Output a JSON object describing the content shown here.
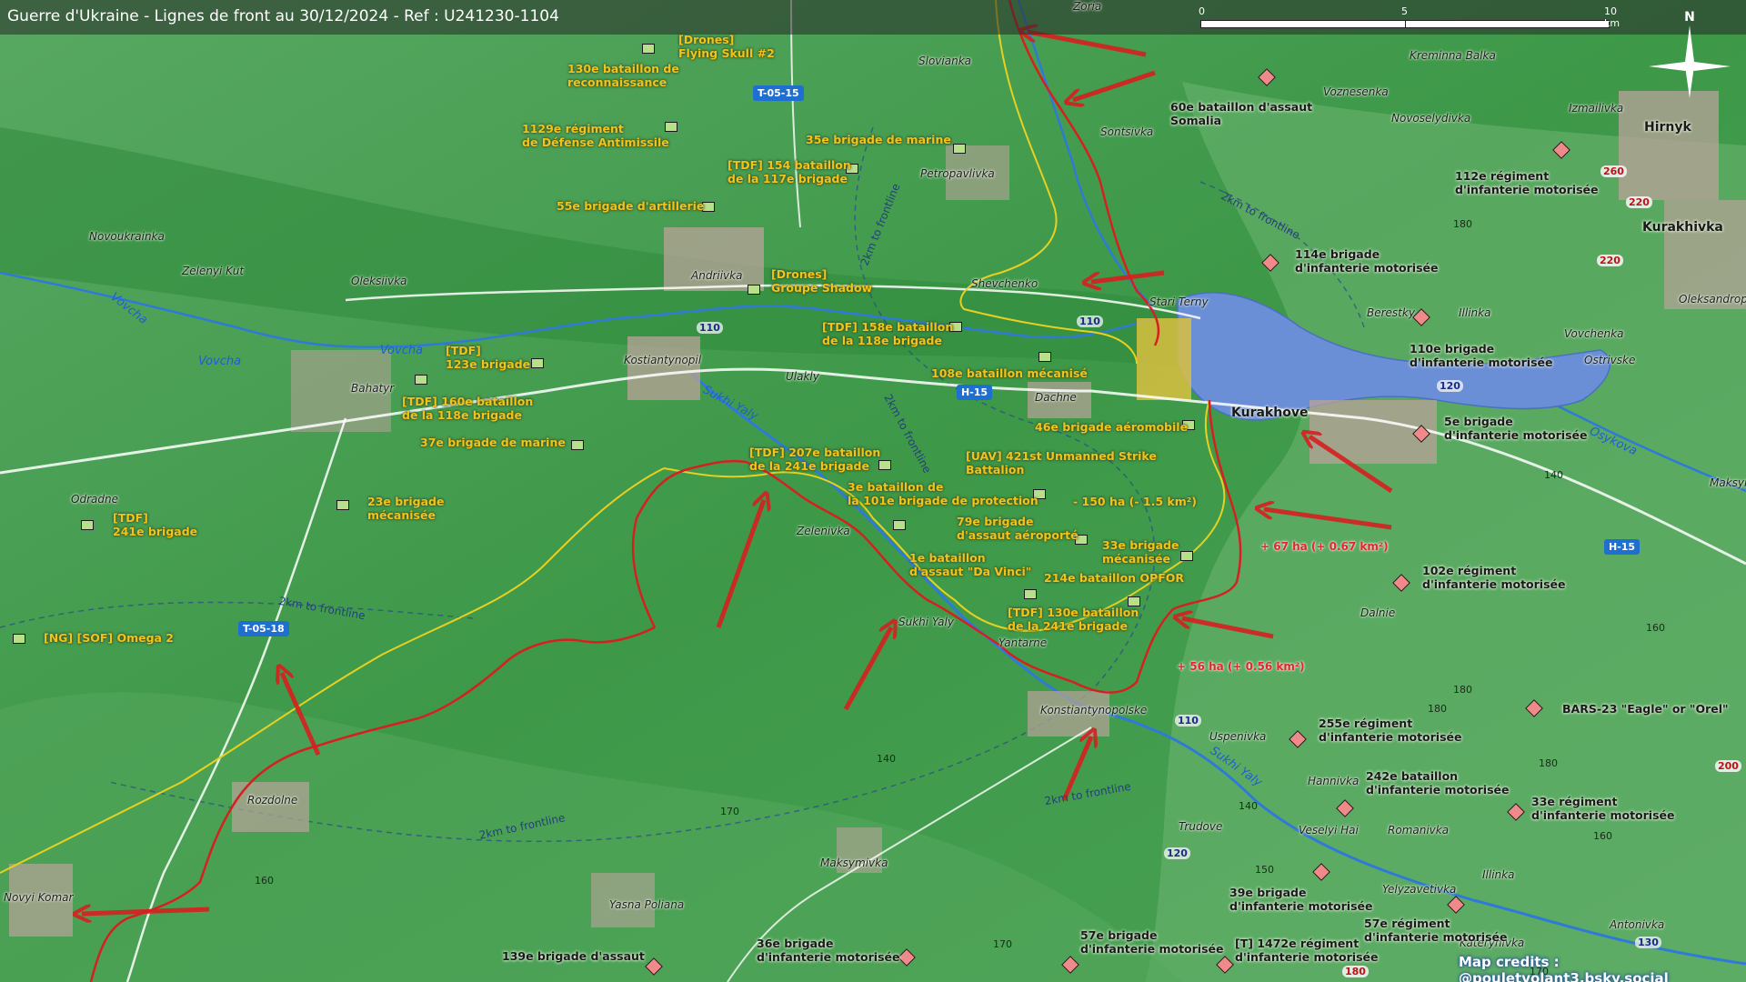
{
  "title": "Guerre d'Ukraine - Lignes de front au 30/12/2024 - Ref : U241230-1104",
  "scale": {
    "labels": [
      "0",
      "5",
      "10 km"
    ]
  },
  "compass": {
    "label": "N",
    "icon": "compass-rose-icon"
  },
  "credits": "Map credits : @pouletvolant3.bsky.social",
  "colors": {
    "terrain": "#3f9a4a",
    "frontline": "#d62020",
    "secondary_line": "#e8d020",
    "ua_unit_text": "#f0c419",
    "ru_unit_text": "#1a1a1a",
    "water": "#6b8fd6",
    "road_badge": "#1f6fd0"
  },
  "towns": [
    {
      "name": "Slovianka"
    },
    {
      "name": "Sontsivka"
    },
    {
      "name": "Voznesenka"
    },
    {
      "name": "Kreminna Balka"
    },
    {
      "name": "Novoselydivka"
    },
    {
      "name": "Izmailivka"
    },
    {
      "name": "Petropavlivka"
    },
    {
      "name": "Novoukrainka"
    },
    {
      "name": "Zelenyi Kut"
    },
    {
      "name": "Oleksiivka"
    },
    {
      "name": "Andriivka"
    },
    {
      "name": "Shevchenko"
    },
    {
      "name": "Stari Terny"
    },
    {
      "name": "Berestky"
    },
    {
      "name": "Illinka"
    },
    {
      "name": "Oleksandropil"
    },
    {
      "name": "Vovchenka"
    },
    {
      "name": "Ostrivske"
    },
    {
      "name": "Kostiantynopil"
    },
    {
      "name": "Ulakly"
    },
    {
      "name": "Bahatyr"
    },
    {
      "name": "Dachne"
    },
    {
      "name": "Odradne"
    },
    {
      "name": "Rozdolne"
    },
    {
      "name": "Zelenivka"
    },
    {
      "name": "Sukhi Yaly"
    },
    {
      "name": "Yantarne"
    },
    {
      "name": "Dalnie"
    },
    {
      "name": "Konstiantynopolske"
    },
    {
      "name": "Uspenivka"
    },
    {
      "name": "Hannivka"
    },
    {
      "name": "Trudove"
    },
    {
      "name": "Veselyi Hai"
    },
    {
      "name": "Romanivka"
    },
    {
      "name": "Illinka"
    },
    {
      "name": "Yelyzavetivka"
    },
    {
      "name": "Antonivka"
    },
    {
      "name": "Katerynivka"
    },
    {
      "name": "Maksymivka"
    },
    {
      "name": "Yasna Poliana"
    },
    {
      "name": "Novyi Komar"
    },
    {
      "name": "Maksym"
    },
    {
      "name": "Zoria"
    }
  ],
  "major_towns": [
    {
      "name": "Hirnyk"
    },
    {
      "name": "Kurakhivka"
    },
    {
      "name": "Kurakhove"
    }
  ],
  "rivers": [
    {
      "name": "Vovcha"
    },
    {
      "name": "Vovcha"
    },
    {
      "name": "Vovcha"
    },
    {
      "name": "Sukhi Yaly"
    },
    {
      "name": "Sukhi Yaly"
    },
    {
      "name": "Osykova"
    }
  ],
  "road_badges": [
    {
      "label": "T-05-15"
    },
    {
      "label": "H-15"
    },
    {
      "label": "T-05-18"
    },
    {
      "label": "H-15"
    }
  ],
  "road_numbers": [
    {
      "label": "110"
    },
    {
      "label": "110"
    },
    {
      "label": "120"
    },
    {
      "label": "110"
    },
    {
      "label": "120"
    },
    {
      "label": "130"
    }
  ],
  "red_road_numbers": [
    {
      "label": "260"
    },
    {
      "label": "220"
    },
    {
      "label": "220"
    },
    {
      "label": "180"
    },
    {
      "label": "200"
    }
  ],
  "elevations": [
    {
      "label": "180"
    },
    {
      "label": "140"
    },
    {
      "label": "160"
    },
    {
      "label": "180"
    },
    {
      "label": "140"
    },
    {
      "label": "180"
    },
    {
      "label": "170"
    },
    {
      "label": "140"
    },
    {
      "label": "150"
    },
    {
      "label": "160"
    },
    {
      "label": "160"
    },
    {
      "label": "170"
    },
    {
      "label": "170"
    },
    {
      "label": "180"
    }
  ],
  "frontline_labels": [
    {
      "label": "2km to frontline"
    },
    {
      "label": "2km to frontline"
    },
    {
      "label": "2km to frontline"
    },
    {
      "label": "2km to frontline"
    },
    {
      "label": "2km to frontline"
    },
    {
      "label": "2km to frontline"
    }
  ],
  "ua_units": [
    {
      "label": "[Drones]\nFlying Skull #2"
    },
    {
      "label": "130e bataillon de\nreconnaissance"
    },
    {
      "label": "1129e régiment\nde Défense Antimissile"
    },
    {
      "label": "35e brigade de marine"
    },
    {
      "label": "[TDF] 154 bataillon\nde la 117e brigade"
    },
    {
      "label": "55e brigade d'artillerie"
    },
    {
      "label": "[Drones]\nGroupe Shadow"
    },
    {
      "label": "[TDF] 158e bataillon\nde la 118e brigade"
    },
    {
      "label": "[TDF]\n123e brigade"
    },
    {
      "label": "108e bataillon mécanisé"
    },
    {
      "label": "[TDF] 160e bataillon\nde la 118e brigade"
    },
    {
      "label": "46e brigade aéromobile"
    },
    {
      "label": "37e brigade de marine"
    },
    {
      "label": "[TDF] 207e bataillon\nde la 241e brigade"
    },
    {
      "label": "[UAV] 421st Unmanned Strike\nBattalion"
    },
    {
      "label": "3e bataillon de\nla 101e brigade de protection"
    },
    {
      "label": "23e brigade\nmécanisée"
    },
    {
      "label": "[TDF]\n241e brigade"
    },
    {
      "label": "79e brigade\nd'assaut aéroporté"
    },
    {
      "label": "33e brigade\nmécanisée"
    },
    {
      "label": "1e bataillon\nd'assaut \"Da Vinci\""
    },
    {
      "label": "214e bataillon OPFOR"
    },
    {
      "label": "[TDF] 130e bataillon\nde la 241e brigade"
    },
    {
      "label": "[NG] [SOF] Omega 2"
    }
  ],
  "ru_units": [
    {
      "label": "60e bataillon d'assaut\nSomalia"
    },
    {
      "label": "112e régiment\nd'infanterie motorisée"
    },
    {
      "label": "114e brigade\nd'infanterie motorisée"
    },
    {
      "label": "110e brigade\nd'infanterie motorisée"
    },
    {
      "label": "5e brigade\nd'infanterie motorisée"
    },
    {
      "label": "102e régiment\nd'infanterie motorisée"
    },
    {
      "label": "BARS-23 \"Eagle\" or \"Orel\""
    },
    {
      "label": "255e régiment\nd'infanterie motorisée"
    },
    {
      "label": "242e bataillon\nd'infanterie motorisée"
    },
    {
      "label": "33e régiment\nd'infanterie motorisée"
    },
    {
      "label": "39e brigade\nd'infanterie motorisée"
    },
    {
      "label": "57e régiment\nd'infanterie motorisée"
    },
    {
      "label": "57e brigade\nd'infanterie motorisée"
    },
    {
      "label": "[T] 1472e régiment\nd'infanterie motorisée"
    },
    {
      "label": "36e brigade\nd'infanterie motorisée"
    },
    {
      "label": "139e brigade d'assaut"
    }
  ],
  "territory_changes": [
    {
      "label": "- 150 ha (- 1.5 km²)"
    },
    {
      "label": "+ 67 ha (+ 0.67 km²)"
    },
    {
      "label": "+ 56 ha (+ 0.56 km²)"
    }
  ]
}
